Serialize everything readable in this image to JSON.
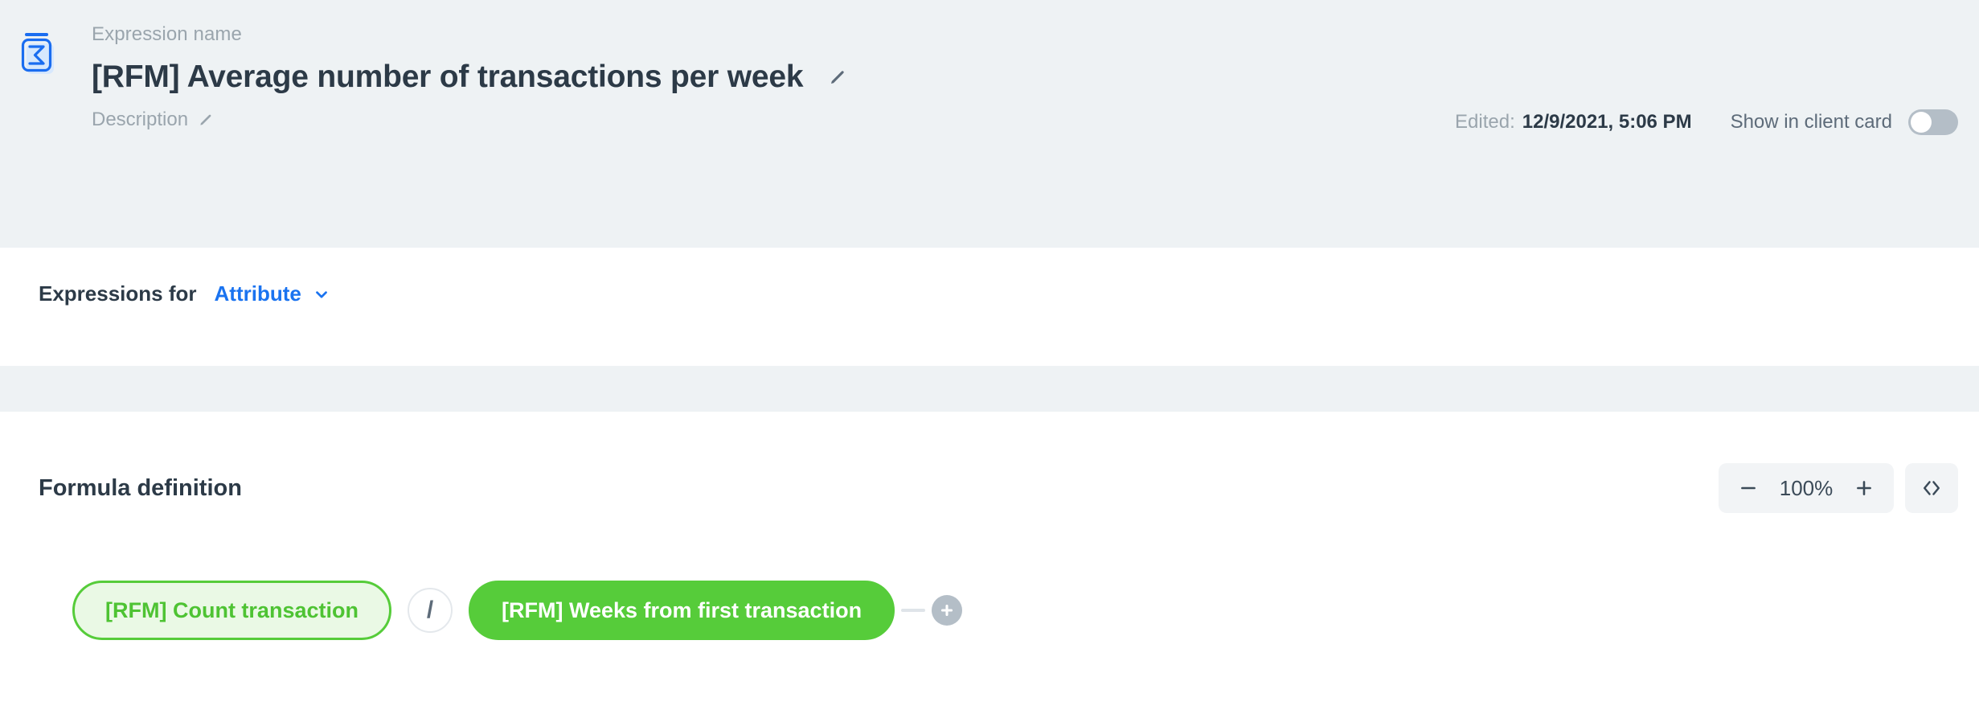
{
  "header": {
    "icon_name": "sigma-expression-icon",
    "expression_name_label": "Expression name",
    "title": "[RFM] Average number of transactions per week",
    "title_edit_icon": "pencil-icon",
    "description_label": "Description",
    "description_edit_icon": "pencil-icon",
    "edited_label": "Edited:",
    "edited_value": "12/9/2021, 5:06 PM",
    "show_in_client_card_label": "Show in client card",
    "toggle_state": "off"
  },
  "expressions_for": {
    "label": "Expressions for",
    "selected": "Attribute",
    "chevron_icon": "chevron-down-icon"
  },
  "formula": {
    "title": "Formula definition",
    "zoom": {
      "minus_label": "−",
      "value": "100%",
      "plus_label": "+",
      "code_label": "‹›"
    },
    "nodes": [
      {
        "label": "[RFM] Count transaction",
        "style": "outline"
      },
      {
        "label": "[RFM] Weeks from first transaction",
        "style": "solid"
      }
    ],
    "operator": "/",
    "add_button_label": "+"
  },
  "colors": {
    "header_bg": "#eef2f4",
    "accent_blue": "#1a73f0",
    "green": "#56cc3a",
    "green_light_bg": "#eaf9e5",
    "text_dark": "#2c3a47",
    "text_muted": "#9aa5ad",
    "toggle_off": "#b4bec7"
  }
}
